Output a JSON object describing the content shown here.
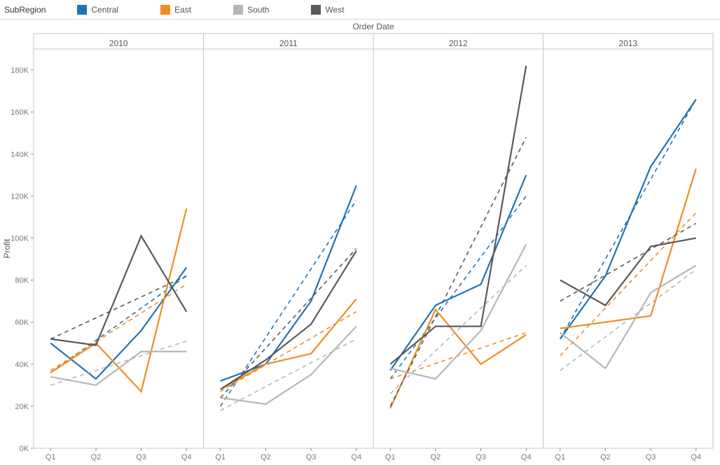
{
  "legend": {
    "title": "SubRegion",
    "items": [
      {
        "name": "Central",
        "color": "#1f74b2"
      },
      {
        "name": "East",
        "color": "#ee8d22"
      },
      {
        "name": "South",
        "color": "#b6b6b6"
      },
      {
        "name": "West",
        "color": "#595959"
      }
    ]
  },
  "axes": {
    "super_title": "Order Date",
    "panel_titles": [
      "2010",
      "2011",
      "2012",
      "2013"
    ],
    "x_categories": [
      "Q1",
      "Q2",
      "Q3",
      "Q4"
    ],
    "ylabel": "Profit",
    "y_ticks": [
      0,
      20000,
      40000,
      60000,
      80000,
      100000,
      120000,
      140000,
      160000,
      180000
    ],
    "y_tick_labels": [
      "0K",
      "20K",
      "40K",
      "60K",
      "80K",
      "100K",
      "120K",
      "140K",
      "160K",
      "180K"
    ]
  },
  "chart_data": {
    "type": "line",
    "faceted_by": "year",
    "categories": [
      "Q1",
      "Q2",
      "Q3",
      "Q4"
    ],
    "ylabel": "Profit",
    "ylim": [
      0,
      190000
    ],
    "panels": [
      {
        "year": "2010",
        "series": [
          {
            "name": "Central",
            "color": "#1f74b2",
            "values": [
              50000,
              33000,
              56000,
              86000
            ],
            "trend": [
              36000,
              82000
            ]
          },
          {
            "name": "East",
            "color": "#ee8d22",
            "values": [
              36000,
              50000,
              27000,
              114000
            ],
            "trend": [
              37000,
              78000
            ]
          },
          {
            "name": "South",
            "color": "#b6b6b6",
            "values": [
              34000,
              30000,
              46000,
              46000
            ],
            "trend": [
              30000,
              51000
            ]
          },
          {
            "name": "West",
            "color": "#595959",
            "values": [
              52000,
              49000,
              101000,
              65000
            ],
            "trend": [
              52000,
              82000
            ]
          }
        ]
      },
      {
        "year": "2011",
        "series": [
          {
            "name": "Central",
            "color": "#1f74b2",
            "values": [
              32000,
              40000,
              70000,
              125000
            ],
            "trend": [
              20000,
              118000
            ]
          },
          {
            "name": "East",
            "color": "#ee8d22",
            "values": [
              28000,
              40000,
              45000,
              71000
            ],
            "trend": [
              27000,
              65000
            ]
          },
          {
            "name": "South",
            "color": "#b6b6b6",
            "values": [
              24000,
              21000,
              35000,
              58000
            ],
            "trend": [
              18000,
              52000
            ]
          },
          {
            "name": "West",
            "color": "#595959",
            "values": [
              28000,
              42000,
              59000,
              94000
            ],
            "trend": [
              24000,
              95000
            ]
          }
        ]
      },
      {
        "year": "2012",
        "series": [
          {
            "name": "Central",
            "color": "#1f74b2",
            "values": [
              37000,
              68000,
              78000,
              130000
            ],
            "trend": [
              33000,
              120000
            ]
          },
          {
            "name": "East",
            "color": "#ee8d22",
            "values": [
              19000,
              66000,
              40000,
              54000
            ],
            "trend": [
              33000,
              55000
            ]
          },
          {
            "name": "South",
            "color": "#b6b6b6",
            "values": [
              38000,
              33000,
              56000,
              97000
            ],
            "trend": [
              26000,
              87000
            ]
          },
          {
            "name": "West",
            "color": "#595959",
            "values": [
              40000,
              58000,
              58000,
              182000
            ],
            "trend": [
              20000,
              148000
            ]
          }
        ]
      },
      {
        "year": "2013",
        "series": [
          {
            "name": "Central",
            "color": "#1f74b2",
            "values": [
              52000,
              82000,
              134000,
              166000
            ],
            "trend": [
              52000,
              166000
            ]
          },
          {
            "name": "East",
            "color": "#ee8d22",
            "values": [
              57000,
              60000,
              63000,
              133000
            ],
            "trend": [
              44000,
              112000
            ]
          },
          {
            "name": "South",
            "color": "#b6b6b6",
            "values": [
              55000,
              38000,
              74000,
              87000
            ],
            "trend": [
              37000,
              85000
            ]
          },
          {
            "name": "West",
            "color": "#595959",
            "values": [
              80000,
              68000,
              96000,
              100000
            ],
            "trend": [
              70000,
              107000
            ]
          }
        ]
      }
    ]
  }
}
